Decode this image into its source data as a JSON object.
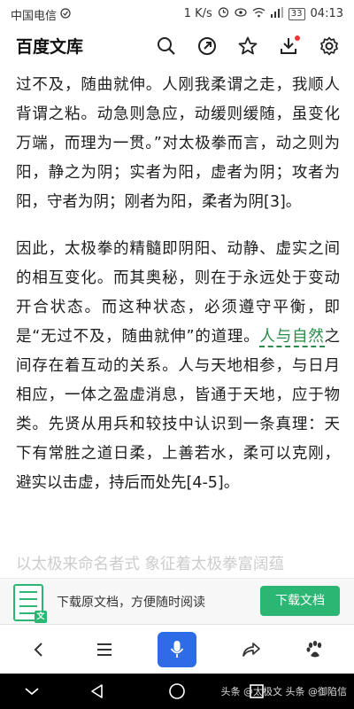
{
  "status_bar": {
    "carrier": "中国电信",
    "speed": "1 K/s",
    "battery": "33",
    "time": "04:13"
  },
  "app_bar": {
    "title": "百度文库",
    "icons": [
      "search-icon",
      "share-icon",
      "star-icon",
      "download-icon",
      "settings-icon"
    ]
  },
  "content": {
    "paragraph1": "过不及，随曲就伸。人刚我柔谓之走，我顺人背谓之粘。动急则急应，动缓则缓随，虽变化万端，而理为一贯。”对太极拳而言，动之则为阳，静之为阴；实者为阳，虚者为阴；攻者为阳，守者为阴；刚者为阳，柔者为阴[3]。",
    "paragraph2_before": "因此，太极拳的精髓即阴阳、动静、虚实之间的相互变化。而其奥秘，则在于永远处于变动开合状态。而这种状态，必须遵守平衡，即是“无过不及，随曲就伸”的道理。",
    "paragraph2_link": "人与自然",
    "paragraph2_after": "之间存在着互动的关系。人与天地相参，与日月相应，一体之盈虚消息，皆通于天地，应于物类。先贤从用兵和较技中认识到一条真理：天下有常胜之道日柔，上善若水，柔可以克刚，避实以击虚，持后而处先[4-5]。",
    "faded_line": "以太极来命名者式 象征着太极拳富阔蕴"
  },
  "banner": {
    "text": "下载原文档，方便随时阅读",
    "button": "下载文档",
    "doc_badge": "文"
  },
  "watermark": "头条 @太极文 头条 @御陷信",
  "colors": {
    "accent": "#2bb673",
    "mic": "#2e6be6",
    "link": "#2a8a4a"
  }
}
